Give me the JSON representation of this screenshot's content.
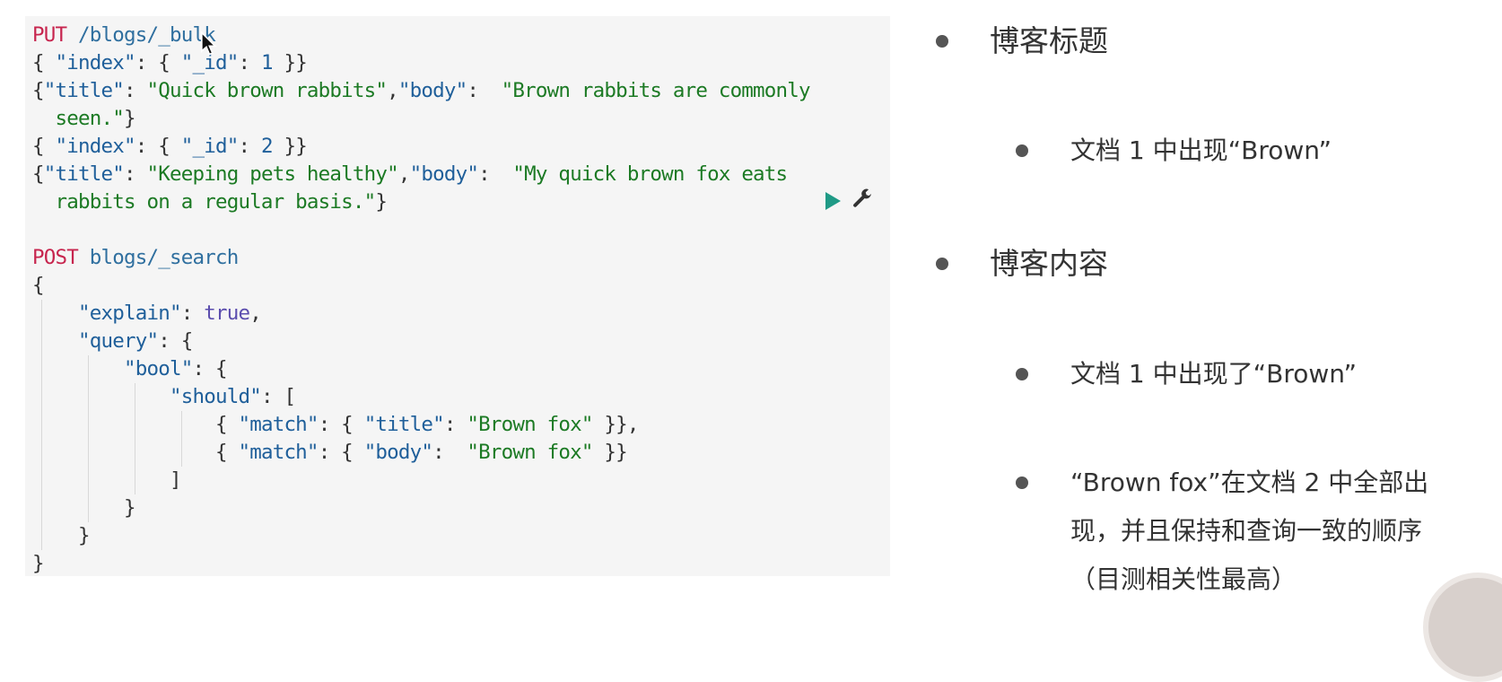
{
  "editor": {
    "lines": [
      [
        {
          "t": "PUT",
          "c": "method"
        },
        {
          "t": " /blogs/_bulk",
          "c": "url"
        }
      ],
      [
        {
          "t": "{ "
        },
        {
          "t": "\"index\"",
          "c": "key"
        },
        {
          "t": ": { "
        },
        {
          "t": "\"_id\"",
          "c": "key"
        },
        {
          "t": ": "
        },
        {
          "t": "1",
          "c": "num"
        },
        {
          "t": " }}"
        }
      ],
      [
        {
          "t": "{"
        },
        {
          "t": "\"title\"",
          "c": "key"
        },
        {
          "t": ": "
        },
        {
          "t": "\"Quick brown rabbits\"",
          "c": "str"
        },
        {
          "t": ","
        },
        {
          "t": "\"body\"",
          "c": "key"
        },
        {
          "t": ":  "
        },
        {
          "t": "\"Brown rabbits are commonly",
          "c": "str"
        }
      ],
      [
        {
          "t": "  "
        },
        {
          "t": "seen.\"",
          "c": "str"
        },
        {
          "t": "}"
        }
      ],
      [
        {
          "t": "{ "
        },
        {
          "t": "\"index\"",
          "c": "key"
        },
        {
          "t": ": { "
        },
        {
          "t": "\"_id\"",
          "c": "key"
        },
        {
          "t": ": "
        },
        {
          "t": "2",
          "c": "num"
        },
        {
          "t": " }}"
        }
      ],
      [
        {
          "t": "{"
        },
        {
          "t": "\"title\"",
          "c": "key"
        },
        {
          "t": ": "
        },
        {
          "t": "\"Keeping pets healthy\"",
          "c": "str"
        },
        {
          "t": ","
        },
        {
          "t": "\"body\"",
          "c": "key"
        },
        {
          "t": ":  "
        },
        {
          "t": "\"My quick brown fox eats",
          "c": "str"
        }
      ],
      [
        {
          "t": "  "
        },
        {
          "t": "rabbits on a regular basis.\"",
          "c": "str"
        },
        {
          "t": "}"
        }
      ],
      [
        {
          "t": ""
        }
      ],
      [
        {
          "t": "POST",
          "c": "method"
        },
        {
          "t": " blogs/_search",
          "c": "url"
        }
      ],
      [
        {
          "t": "{"
        }
      ],
      [
        {
          "t": "    "
        },
        {
          "t": "\"explain\"",
          "c": "key"
        },
        {
          "t": ": "
        },
        {
          "t": "true",
          "c": "bool"
        },
        {
          "t": ","
        }
      ],
      [
        {
          "t": "    "
        },
        {
          "t": "\"query\"",
          "c": "key"
        },
        {
          "t": ": {"
        }
      ],
      [
        {
          "t": "        "
        },
        {
          "t": "\"bool\"",
          "c": "key"
        },
        {
          "t": ": {"
        }
      ],
      [
        {
          "t": "            "
        },
        {
          "t": "\"should\"",
          "c": "key"
        },
        {
          "t": ": ["
        }
      ],
      [
        {
          "t": "                "
        },
        {
          "t": "{ "
        },
        {
          "t": "\"match\"",
          "c": "key"
        },
        {
          "t": ": { "
        },
        {
          "t": "\"title\"",
          "c": "key"
        },
        {
          "t": ": "
        },
        {
          "t": "\"Brown fox\"",
          "c": "str"
        },
        {
          "t": " }},"
        }
      ],
      [
        {
          "t": "                "
        },
        {
          "t": "{ "
        },
        {
          "t": "\"match\"",
          "c": "key"
        },
        {
          "t": ": { "
        },
        {
          "t": "\"body\"",
          "c": "key"
        },
        {
          "t": ":  "
        },
        {
          "t": "\"Brown fox\"",
          "c": "str"
        },
        {
          "t": " }}"
        }
      ],
      [
        {
          "t": "            ]"
        }
      ],
      [
        {
          "t": "        }"
        }
      ],
      [
        {
          "t": "    }"
        }
      ],
      [
        {
          "t": "}"
        }
      ]
    ],
    "run_icon": "play-icon",
    "settings_icon": "wrench-icon"
  },
  "slide": {
    "bullet1": "博客标题",
    "bullet1_sub1": "文档 1 中出现“Brown”",
    "bullet2": "博客内容",
    "bullet2_sub1": "文档 1 中出现了“Brown”",
    "bullet2_sub2_line1": "“Brown fox”在文档 2 中全部出",
    "bullet2_sub2_line2": "现，并且保持和查询一致的顺序",
    "bullet2_sub2_line3": "（目测相关性最高）"
  }
}
